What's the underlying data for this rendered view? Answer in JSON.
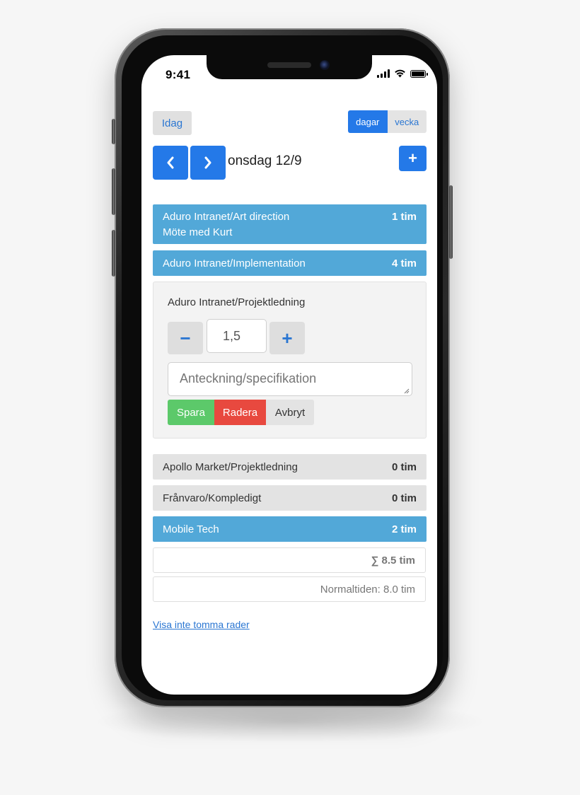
{
  "status": {
    "time": "9:41"
  },
  "toolbar": {
    "today_label": "Idag",
    "view_days": "dagar",
    "view_week": "vecka",
    "add_label": "+"
  },
  "date": {
    "label": "onsdag 12/9"
  },
  "entries": [
    {
      "name": "Aduro Intranet/Art direction",
      "hours": "1 tim",
      "note": "Möte med Kurt",
      "style": "blue"
    },
    {
      "name": "Aduro Intranet/Implementation",
      "hours": "4 tim",
      "style": "blue"
    }
  ],
  "editor": {
    "title": "Aduro Intranet/Projektledning",
    "minus_label": "−",
    "plus_label": "+",
    "quantity": "1,5",
    "note_placeholder": "Anteckning/specifikation",
    "save_label": "Spara",
    "delete_label": "Radera",
    "cancel_label": "Avbryt"
  },
  "entries_after": [
    {
      "name": "Apollo Market/Projektledning",
      "hours": "0 tim",
      "style": "grey"
    },
    {
      "name": "Frånvaro/Kompledigt",
      "hours": "0 tim",
      "style": "grey"
    },
    {
      "name": "Mobile Tech",
      "hours": "2 tim",
      "style": "blue"
    }
  ],
  "summary": {
    "total": "∑ 8.5 tim",
    "normal": "Normaltiden: 8.0 tim"
  },
  "footer": {
    "toggle_link": "Visa inte tomma rader"
  },
  "colors": {
    "accent": "#2479e8",
    "row_blue": "#52a8d8",
    "save": "#5cc96a",
    "delete": "#e8493f"
  }
}
